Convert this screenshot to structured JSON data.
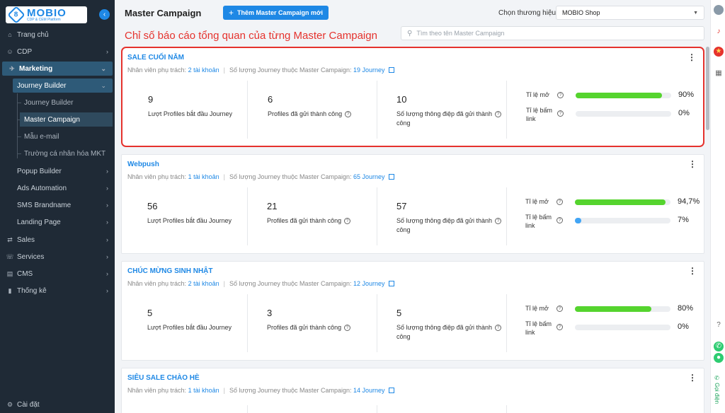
{
  "sidebar": {
    "logo": {
      "brand": "MOBIO",
      "tagline": "CDP & CEM Platform"
    },
    "items": [
      {
        "label": "Trang chủ",
        "icon": "home-icon"
      },
      {
        "label": "CDP",
        "icon": "user-icon"
      },
      {
        "label": "Marketing",
        "icon": "megaphone-icon"
      },
      {
        "label": "Journey Builder"
      },
      {
        "label": "Journey Builder"
      },
      {
        "label": "Master Campaign"
      },
      {
        "label": "Mẫu e-mail"
      },
      {
        "label": "Trường cá nhân hóa MKT"
      },
      {
        "label": "Popup Builder"
      },
      {
        "label": "Ads Automation"
      },
      {
        "label": "SMS Brandname"
      },
      {
        "label": "Landing Page"
      },
      {
        "label": "Sales",
        "icon": "sales-icon"
      },
      {
        "label": "Services",
        "icon": "services-icon"
      },
      {
        "label": "CMS",
        "icon": "cms-icon"
      },
      {
        "label": "Thống kê",
        "icon": "stats-icon"
      }
    ],
    "settings_label": "Cài đặt"
  },
  "header": {
    "title": "Master Campaign",
    "add_button": "Thêm Master Campaign mới",
    "brand_label": "Chọn thương hiệu",
    "brand_value": "MOBIO Shop"
  },
  "annotation": "Chỉ số báo cáo tổng quan của từng Master Campaign",
  "search": {
    "placeholder": "Tìm theo tên Master Campaign"
  },
  "labels": {
    "staff": "Nhân viên phụ trách:",
    "journey_count": "Số lượng Journey thuộc Master Campaign:",
    "profiles_started": "Lượt Profiles bắt đầu Journey",
    "profiles_sent": "Profiles đã gửi thành công",
    "messages_sent_l1": "Số lượng thông điệp đã gửi thành",
    "messages_sent_l2": "công",
    "open_rate": "Tỉ lệ mở",
    "click_rate_l1": "Tỉ lệ bấm",
    "click_rate_l2": "link"
  },
  "campaigns": [
    {
      "name": "SALE CUỐI NĂM",
      "staff": "2 tài khoản",
      "journeys": "19 Journey",
      "started": "9",
      "sent_profiles": "6",
      "sent_messages": "10",
      "open_rate": 0.9,
      "open_rate_text": "90%",
      "click_rate": 0.0,
      "click_rate_text": "0%"
    },
    {
      "name": "Webpush",
      "staff": "1 tài khoản",
      "journeys": "65 Journey",
      "started": "56",
      "sent_profiles": "21",
      "sent_messages": "57",
      "open_rate": 0.947,
      "open_rate_text": "94,7%",
      "click_rate": 0.07,
      "click_rate_text": "7%"
    },
    {
      "name": "CHÚC MỪNG SINH NHẬT",
      "staff": "2 tài khoản",
      "journeys": "12 Journey",
      "started": "5",
      "sent_profiles": "3",
      "sent_messages": "5",
      "open_rate": 0.8,
      "open_rate_text": "80%",
      "click_rate": 0.0,
      "click_rate_text": "0%"
    },
    {
      "name": "SIÊU SALE CHÀO HÈ",
      "staff": "1 tài khoản",
      "journeys": "14 Journey"
    }
  ],
  "rail": {
    "call_label": "Gọi điện"
  },
  "colors": {
    "accent": "#1e88e5",
    "highlight": "#e5322d",
    "progress": "#55d42e",
    "sidebar": "#1f2a36"
  }
}
